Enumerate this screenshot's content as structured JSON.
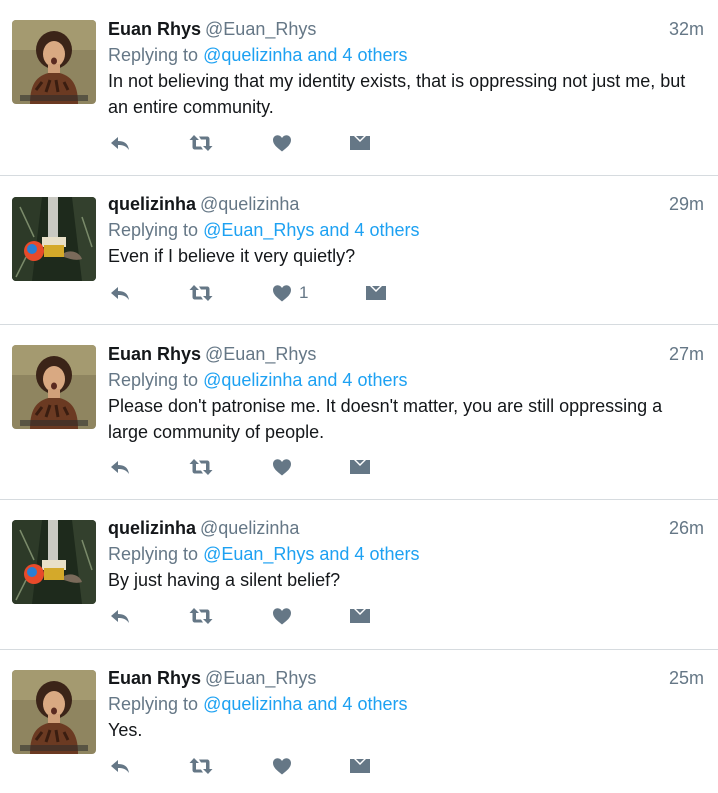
{
  "colors": {
    "link": "#1da1f2",
    "muted": "#657786",
    "text": "#14171a",
    "divider": "#d6dbdf",
    "icon": "#657786"
  },
  "icons": {
    "reply": "reply-icon",
    "retweet": "retweet-icon",
    "like": "heart-icon",
    "message": "direct-message-icon"
  },
  "tweets": [
    {
      "name": "Euan Rhys",
      "handle": "@Euan_Rhys",
      "time": "32m",
      "replying_prefix": "Replying to ",
      "replying_to": "@quelizinha and 4 others",
      "text": "In not believing that my identity exists, that is oppressing not just me, but an entire community.",
      "likes": ""
    },
    {
      "name": "quelizinha",
      "handle": "@quelizinha",
      "time": "29m",
      "replying_prefix": "Replying to ",
      "replying_to": "@Euan_Rhys and 4 others",
      "text": "Even if I believe it very quietly?",
      "likes": "1"
    },
    {
      "name": "Euan Rhys",
      "handle": "@Euan_Rhys",
      "time": "27m",
      "replying_prefix": "Replying to ",
      "replying_to": "@quelizinha and 4 others",
      "text": "Please don't patronise me. It doesn't matter, you are still oppressing a large community of people.",
      "likes": ""
    },
    {
      "name": "quelizinha",
      "handle": "@quelizinha",
      "time": "26m",
      "replying_prefix": "Replying to ",
      "replying_to": "@Euan_Rhys and 4 others",
      "text": "By just having a silent belief?",
      "likes": ""
    },
    {
      "name": "Euan Rhys",
      "handle": "@Euan_Rhys",
      "time": "25m",
      "replying_prefix": "Replying to ",
      "replying_to": "@quelizinha and 4 others",
      "text": "Yes.",
      "likes": ""
    }
  ]
}
